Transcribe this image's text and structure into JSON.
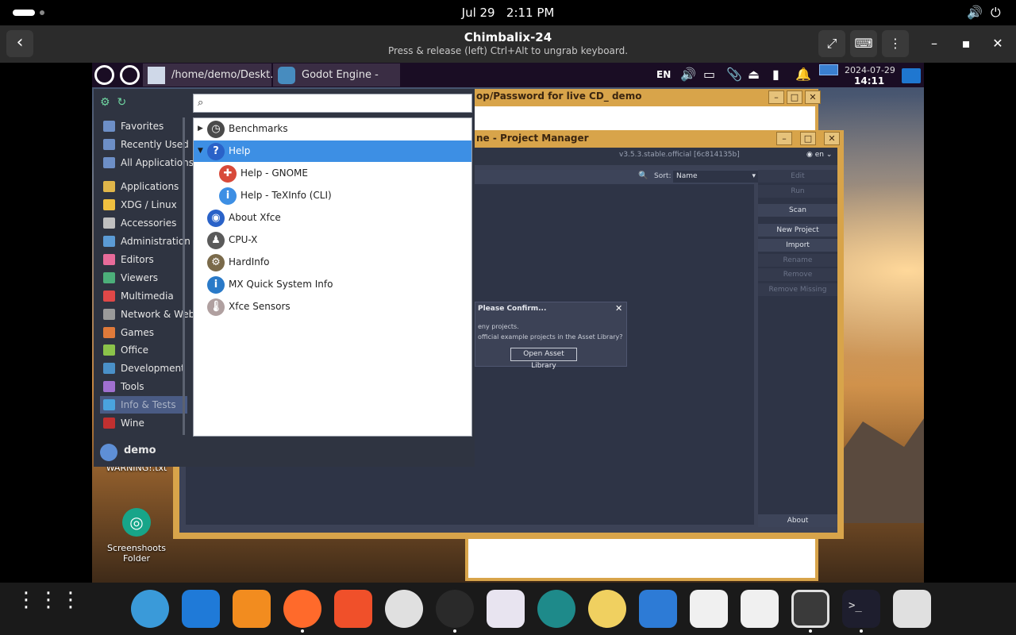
{
  "gnome_bar": {
    "date": "Jul 29",
    "time": "2:11 PM"
  },
  "vm_header": {
    "title": "Chimbalix-24",
    "subtitle": "Press & release (left) Ctrl+Alt to ungrab keyboard.",
    "back_glyph": "‹",
    "fullscreen_glyph": "⤢",
    "keyboard_glyph": "⌨",
    "menu_glyph": "⋮",
    "minimize_glyph": "–",
    "maximize_glyph": "▪",
    "close_glyph": "✕"
  },
  "xfce_panel": {
    "tasks": [
      {
        "label": "/home/demo/Deskt..."
      },
      {
        "label": "Godot Engine - Proj..."
      }
    ],
    "language": "EN",
    "date": "2024-07-29",
    "time": "14:11"
  },
  "background_window": {
    "title": "op/Password for live CD_ demo"
  },
  "godot": {
    "title": "ne - Project Manager",
    "version": "v3.5.3.stable.official [6c814135b]",
    "lang": "en",
    "sort_label": "Sort:",
    "sort_value": "Name",
    "buttons": [
      "Edit",
      "Run",
      "Scan",
      "New Project",
      "Import",
      "Rename",
      "Remove",
      "Remove Missing",
      "About"
    ],
    "dialog": {
      "title": "Please Confirm...",
      "line1": "eny projects.",
      "line2": "official example projects in the Asset Library?",
      "button": "Open Asset Library"
    }
  },
  "desktop": {
    "warning_file": "WARNING!.txt",
    "screenshots_folder": "Screenshoots\nFolder"
  },
  "whisker_menu": {
    "search_placeholder": "",
    "categories": [
      {
        "label": "Favorites",
        "color": "#6d8fc7"
      },
      {
        "label": "Recently Used",
        "color": "#6d8fc7"
      },
      {
        "label": "All Applications",
        "color": "#6d8fc7"
      },
      {
        "label": "Applications",
        "color": "#e0b64a"
      },
      {
        "label": "XDG / Linux",
        "color": "#f0c040"
      },
      {
        "label": "Accessories",
        "color": "#c0c0c0"
      },
      {
        "label": "Administration",
        "color": "#5b9bd5"
      },
      {
        "label": "Editors",
        "color": "#e86b9a"
      },
      {
        "label": "Viewers",
        "color": "#4caf7a"
      },
      {
        "label": "Multimedia",
        "color": "#e04848"
      },
      {
        "label": "Network & Web",
        "color": "#9a9a9a"
      },
      {
        "label": "Games",
        "color": "#e07a3a"
      },
      {
        "label": "Office",
        "color": "#8bc34a"
      },
      {
        "label": "Development",
        "color": "#4a90c8"
      },
      {
        "label": "Tools",
        "color": "#a070d0"
      },
      {
        "label": "Info & Tests",
        "color": "#4aa3df"
      },
      {
        "label": "Wine",
        "color": "#c03030"
      }
    ],
    "active_category": "Info & Tests",
    "apps": [
      {
        "label": "Benchmarks",
        "arrow": "▶",
        "icon": "◷",
        "icon_color": "#4a4a4a",
        "indent": 0
      },
      {
        "label": "Help",
        "arrow": "▼",
        "icon": "?",
        "icon_color": "#2a62c8",
        "indent": 0
      },
      {
        "label": "Help - GNOME",
        "arrow": "",
        "icon": "✚",
        "icon_color": "#d84a3a",
        "indent": 1
      },
      {
        "label": "Help - TeXInfo (CLI)",
        "arrow": "",
        "icon": "i",
        "icon_color": "#3d8fe4",
        "indent": 1
      },
      {
        "label": "About Xfce",
        "arrow": "",
        "icon": "◉",
        "icon_color": "#2a62c8",
        "indent": 0
      },
      {
        "label": "CPU-X",
        "arrow": "",
        "icon": "♟",
        "icon_color": "#5a5a5a",
        "indent": 0
      },
      {
        "label": "HardInfo",
        "arrow": "",
        "icon": "⚙",
        "icon_color": "#7a6a4a",
        "indent": 0
      },
      {
        "label": "MX Quick System Info",
        "arrow": "",
        "icon": "i",
        "icon_color": "#2a7ac8",
        "indent": 0
      },
      {
        "label": "Xfce Sensors",
        "arrow": "",
        "icon": "🌡",
        "icon_color": "#b0a0a0",
        "indent": 0
      }
    ],
    "selected_app": "Help",
    "user": "demo"
  },
  "dock": {
    "apps": [
      {
        "name": "browser-globe",
        "color": "#3a9ad9",
        "running": false
      },
      {
        "name": "vscode",
        "color": "#1f7ad8",
        "running": false
      },
      {
        "name": "vlc",
        "color": "#f28c1f",
        "running": false
      },
      {
        "name": "firefox",
        "color": "#ff6a2b",
        "running": true
      },
      {
        "name": "brave",
        "color": "#f0502a",
        "running": false
      },
      {
        "name": "chrome-dev",
        "color": "#e0e0e0",
        "running": false
      },
      {
        "name": "obs",
        "color": "#2a2a2a",
        "running": true
      },
      {
        "name": "calendar",
        "color": "#e8e4f0",
        "running": false
      },
      {
        "name": "edge-dev",
        "color": "#1e8a8a",
        "running": false
      },
      {
        "name": "speaker",
        "color": "#f0d060",
        "running": false
      },
      {
        "name": "archive",
        "color": "#2d7bd6",
        "running": false
      },
      {
        "name": "software-store",
        "color": "#f0f0f0",
        "running": false
      },
      {
        "name": "text-editor",
        "color": "#f0f0f0",
        "running": false
      },
      {
        "name": "boxes",
        "color": "#4a4a4a",
        "running": true
      },
      {
        "name": "terminal",
        "color": "#1e1e2e",
        "running": true
      },
      {
        "name": "recycle",
        "color": "#e0e0e0",
        "running": false
      }
    ],
    "terminal_prompt": ">_"
  }
}
